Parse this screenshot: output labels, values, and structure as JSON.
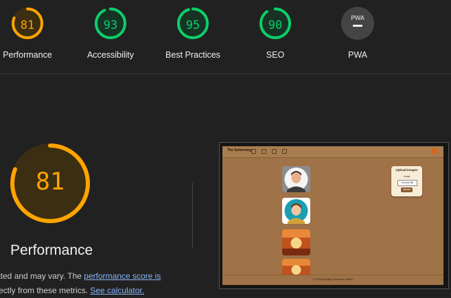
{
  "colors": {
    "average": "#ffa400",
    "pass": "#0cce6b",
    "background": "#212121"
  },
  "gauges": [
    {
      "label": "Performance",
      "score": "81",
      "value": 81,
      "status": "average"
    },
    {
      "label": "Accessibility",
      "score": "93",
      "value": 93,
      "status": "pass"
    },
    {
      "label": "Best Practices",
      "score": "95",
      "value": 95,
      "status": "pass"
    },
    {
      "label": "SEO",
      "score": "90",
      "value": 90,
      "status": "pass"
    }
  ],
  "pwa": {
    "label": "PWA",
    "badge_text": "PWA"
  },
  "performance": {
    "score": "81",
    "value": 81,
    "title": "Performance",
    "desc_part1": "ated and may vary. The ",
    "desc_link1": "performance score is",
    "desc_part2": "rectly from these metrics. ",
    "desc_link2": "See calculator."
  },
  "screenshot": {
    "brand": "The Swimming",
    "upload_title": "Upload Images",
    "upload_label": "Image",
    "choose_file": "Choose file",
    "upload_button": "Upload",
    "footer": "© 2023 Copyright: Swimmers Gallery"
  }
}
